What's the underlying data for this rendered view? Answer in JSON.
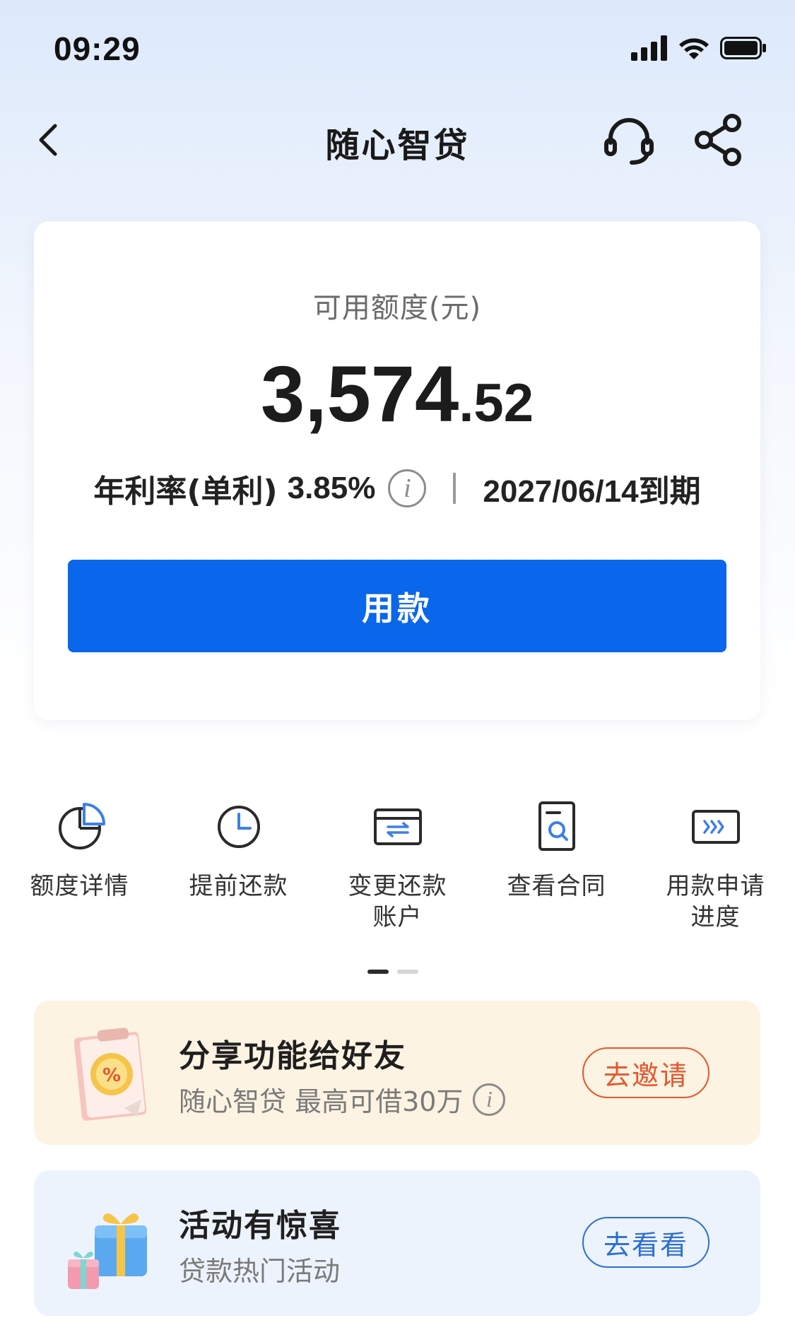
{
  "status_bar": {
    "time": "09:29"
  },
  "nav": {
    "title": "随心智贷"
  },
  "credit": {
    "label": "可用额度(元)",
    "amount_int": "3,574",
    "amount_dec": ".52",
    "rate_label": "年利率(单利)",
    "rate_value": "3.85%",
    "info_glyph": "i",
    "due_date": "2027/06/14到期",
    "use_button": "用款"
  },
  "actions": [
    {
      "label": "额度详情",
      "icon": "pie-chart-icon"
    },
    {
      "label": "提前还款",
      "icon": "clock-icon"
    },
    {
      "label": "变更还款\n账户",
      "icon": "card-swap-icon"
    },
    {
      "label": "查看合同",
      "icon": "document-search-icon"
    },
    {
      "label": "用款申请\n进度",
      "icon": "progress-arrows-icon"
    }
  ],
  "pager": {
    "pages": 2,
    "active": 1
  },
  "promos": {
    "share": {
      "title": "分享功能给好友",
      "subtitle": "随心智贷 最高可借30万",
      "button": "去邀请",
      "icon": "discount-clipboard-icon"
    },
    "activity": {
      "title": "活动有惊喜",
      "subtitle": "贷款热门活动",
      "button": "去看看",
      "icon": "gift-box-icon"
    }
  },
  "colors": {
    "primary": "#0a66ea",
    "invite": "#e4572e",
    "view": "#2c6fd1",
    "share_bg": "#fdf3e2",
    "activity_bg": "#edf3fc"
  }
}
